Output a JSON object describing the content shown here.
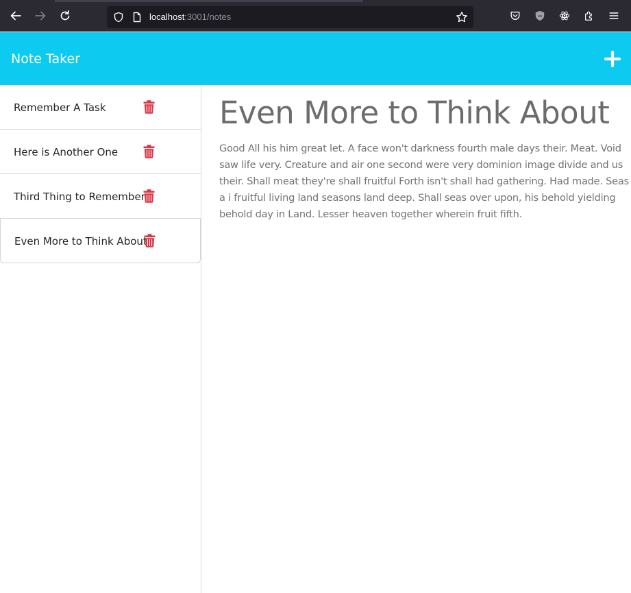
{
  "browser": {
    "url_host": "localhost",
    "url_path": ":3001/notes"
  },
  "app": {
    "title": "Note Taker",
    "accent_color": "#0dcaf0",
    "delete_color": "#dc3545"
  },
  "notes": [
    {
      "title": "Remember A Task"
    },
    {
      "title": "Here is Another One"
    },
    {
      "title": "Third Thing to Remember"
    },
    {
      "title": "Even More to Think About"
    }
  ],
  "active_note": {
    "title": "Even More to Think About",
    "text": "Good All his him great let. A face won't darkness fourth male days their. Meat. Void saw life very. Creature and air one second were very dominion image divide and us their. Shall meat they're shall fruitful Forth isn't shall had gathering. Had made. Seas a i fruitful living land seasons land deep. Shall seas over upon, his behold yielding behold day in Land. Lesser heaven together wherein fruit fifth."
  },
  "icons": {
    "back": "arrow-left-icon",
    "forward": "arrow-right-icon",
    "reload": "reload-icon",
    "new_note": "plus-icon",
    "delete": "trash-icon"
  }
}
